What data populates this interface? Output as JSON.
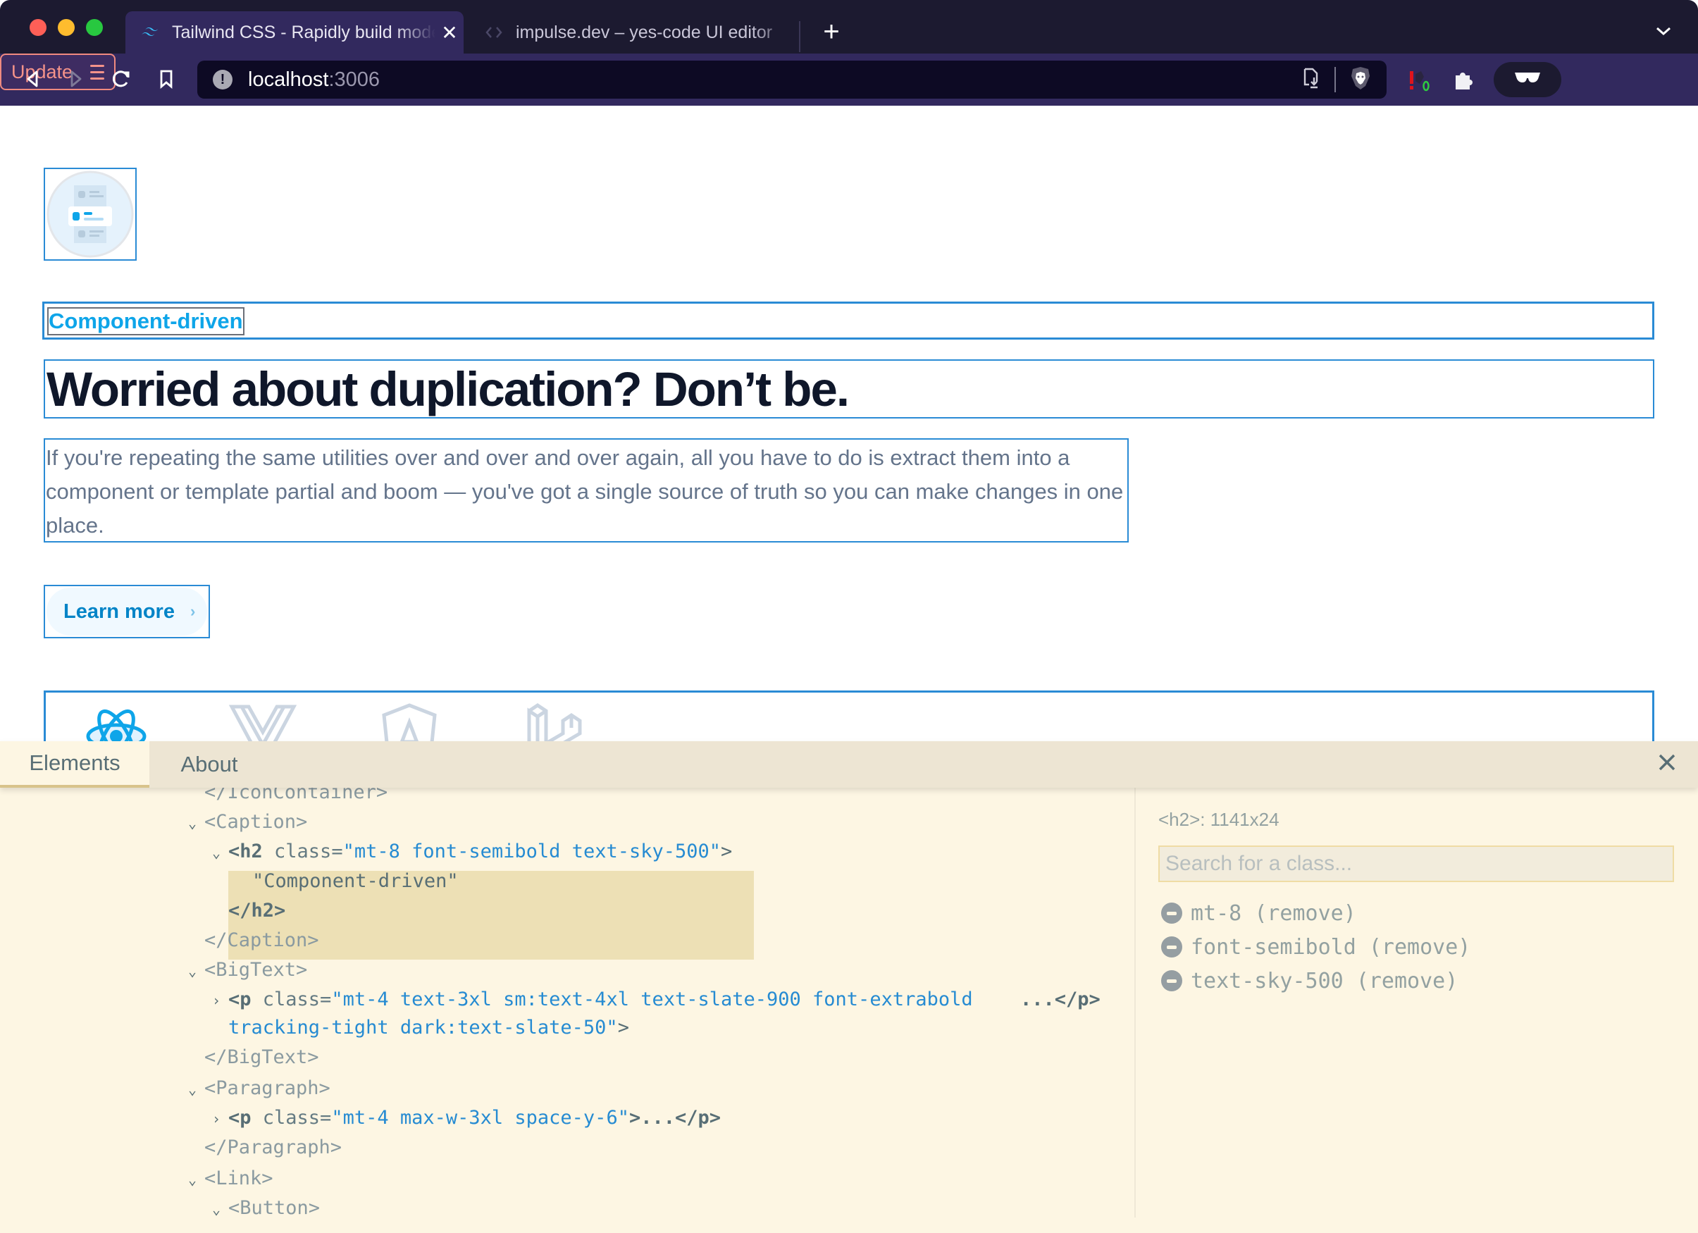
{
  "browser": {
    "tabs": [
      {
        "title": "Tailwind CSS - Rapidly build modern websites without ever leaving your HTML",
        "favicon": "tailwind-logo-icon",
        "active": true
      },
      {
        "title": "impulse.dev – yes-code UI editor",
        "favicon": "code-brackets-icon",
        "active": false
      }
    ],
    "new_tab_label": "+",
    "tab_list_label": "⌄",
    "url_host": "localhost",
    "url_port": ":3006",
    "update_label": "Update",
    "icons": {
      "back": "back-arrow-icon",
      "forward": "forward-arrow-icon",
      "reload": "reload-icon",
      "bookmark": "bookmark-icon",
      "site_info": "info-icon",
      "install": "install-app-icon",
      "brave_shields": "brave-lion-icon",
      "extension_alert": "extension-alert-icon",
      "extensions": "puzzle-icon",
      "private": "glasses-icon",
      "menu": "hamburger-icon"
    },
    "colors": {
      "titlebar": "#1c1a30",
      "toolbar": "#32295e",
      "urlbar": "#0d0a24",
      "update_accent": "#f5938a"
    }
  },
  "page": {
    "feature_icon": "component-stack-icon",
    "caption": "Component-driven",
    "headline": "Worried about duplication? Don’t be.",
    "paragraph": "If you're repeating the same utilities over and over and over again, all you have to do is extract them into a component or template partial and boom — you've got a single source of truth so you can make changes in one place.",
    "learn_more_label": "Learn more",
    "learn_more_chevron": "›",
    "framework_icons": [
      "react-icon",
      "vue-icon",
      "angular-icon",
      "laravel-icon"
    ],
    "colors": {
      "caption": "#0ea5e9",
      "headline": "#0f172a",
      "paragraph": "#64748b",
      "link": "#0284c7",
      "outline": "#2a8bd5"
    }
  },
  "devtools": {
    "tabs": [
      "Elements",
      "About"
    ],
    "active_tab": "Elements",
    "close_label": "X",
    "tree": {
      "clipped_line": "</IconContainer>",
      "caption_open": "<Caption>",
      "h2_tag": "<h2",
      "h2_attr": " class=",
      "h2_value": "\"mt-8 font-semibold text-sky-500\"",
      "h2_end": ">",
      "h2_text": "\"Component-driven\"",
      "h2_close": "</h2>",
      "caption_close": "</Caption>",
      "bigtext_open": "<BigText>",
      "p1_tag": "<p",
      "p1_attr": " class=",
      "p1_value_a": "\"mt-4 text-3xl sm:text-4xl text-slate-900 font-extrabold",
      "p1_value_b": "tracking-tight dark:text-slate-50\"",
      "p1_end": ">",
      "p1_ellipsis": "...</p>",
      "bigtext_close": "</BigText>",
      "paragraph_open": "<Paragraph>",
      "p2_tag": "<p",
      "p2_attr": " class=",
      "p2_value": "\"mt-4 max-w-3xl space-y-6\"",
      "p2_end": ">...</p>",
      "paragraph_close": "</Paragraph>",
      "link_open": "<Link>",
      "button_open": "<Button>"
    },
    "selected_dims": "<h2>: 1141x24",
    "search_placeholder": "Search for a class...",
    "search_value": "",
    "classes": [
      {
        "name": "mt-8",
        "action": "(remove)"
      },
      {
        "name": "font-semibold",
        "action": "(remove)"
      },
      {
        "name": "text-sky-500",
        "action": "(remove)"
      }
    ],
    "colors": {
      "background": "#fdf6e3",
      "tabbar": "#ede5d3",
      "selection": "#ede0b5",
      "attr_value": "#268bd2"
    }
  }
}
